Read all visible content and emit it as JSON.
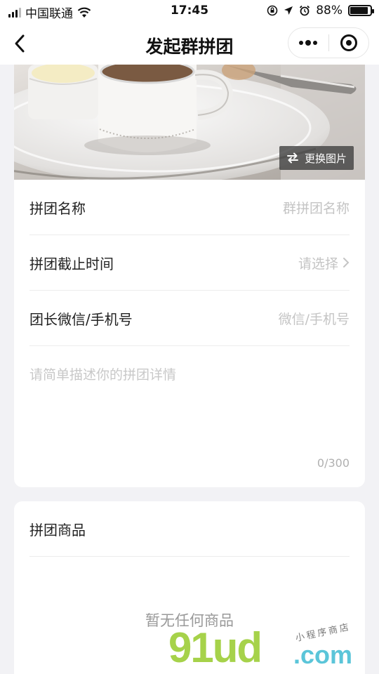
{
  "status_bar": {
    "carrier": "中国联通",
    "time": "17:45",
    "battery_percent": "88%",
    "battery_level": 0.88
  },
  "nav": {
    "title": "发起群拼团"
  },
  "cover": {
    "change_image_label": "更换图片"
  },
  "form": {
    "name_label": "拼团名称",
    "name_placeholder": "群拼团名称",
    "deadline_label": "拼团截止时间",
    "deadline_value": "请选择",
    "contact_label": "团长微信/手机号",
    "contact_placeholder": "微信/手机号",
    "description_placeholder": "请简单描述你的拼团详情",
    "char_count": "0/300"
  },
  "goods": {
    "title": "拼团商品",
    "empty_text": "暂无任何商品"
  },
  "watermark": {
    "brand": "91ud",
    "domain": ".com",
    "handwritten": "小程序商店"
  },
  "colors": {
    "background": "#f2f2f5",
    "card": "#ffffff",
    "placeholder": "#c4c4c4",
    "watermark_green": "#a6d24a",
    "watermark_blue": "#5bc5d9"
  }
}
